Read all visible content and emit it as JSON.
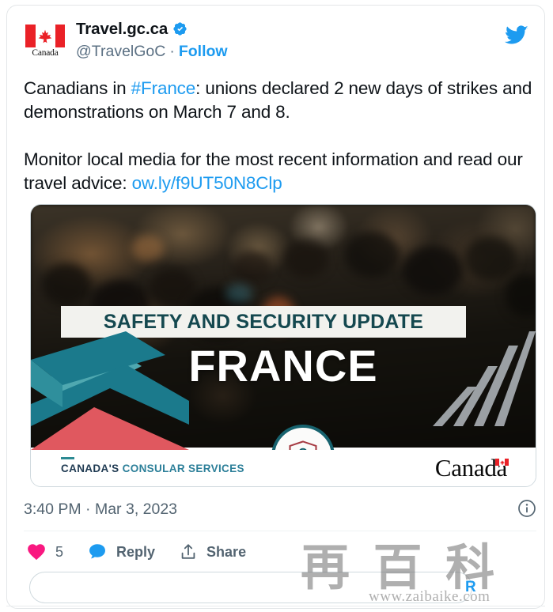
{
  "card": {
    "platform": "Twitter",
    "accent_blue": "#1d9bf0",
    "like_pink": "#f91880"
  },
  "header": {
    "display_name": "Travel.gc.ca",
    "handle": "@TravelGoC",
    "separator": "·",
    "follow_label": "Follow",
    "verified_icon": "verified-badge-icon",
    "brand_icon": "twitter-bird-icon",
    "avatar_wordmark": "Canada",
    "avatar_icon": "canada-flag-avatar"
  },
  "tweet": {
    "paragraph1_pre": "Canadians in ",
    "hashtag": "#France",
    "paragraph1_post": ": unions declared 2 new days of strikes and demonstrations on March 7 and 8.",
    "paragraph2_pre": "Monitor local media for the most recent information and read our travel advice: ",
    "link": "ow.ly/f9UT50N8Clp"
  },
  "media": {
    "banner_text": "SAFETY AND SECURITY UPDATE",
    "country": "FRANCE",
    "badge_icon": "shield-lock-icon",
    "footer": {
      "consular_strong": "CANADA'S ",
      "consular_rest": "CONSULAR SERVICES",
      "wordmark": "Canada",
      "wordmark_flag_icon": "canada-flag-icon"
    },
    "colors": {
      "teal_dark": "#17626e",
      "teal_mid": "#1b7a8c",
      "teal_light": "#4fa8b0",
      "red": "#e0585f",
      "gray_chevron": "#9aa0a6",
      "banner_text_color": "#14484f"
    }
  },
  "meta": {
    "time": "3:40 PM",
    "separator": "·",
    "date": "Mar 3, 2023",
    "info_icon": "info-circle-icon"
  },
  "actions": {
    "like": {
      "icon": "heart-icon",
      "count": "5"
    },
    "reply": {
      "icon": "comment-bubble-icon",
      "label": "Reply"
    },
    "share": {
      "icon": "share-upload-icon",
      "label": "Share"
    }
  },
  "composer": {
    "value": "",
    "placeholder": "",
    "action_label": "Read"
  },
  "watermark": {
    "logo_text": "再 百 科",
    "url": "www.zaibaike.com"
  }
}
